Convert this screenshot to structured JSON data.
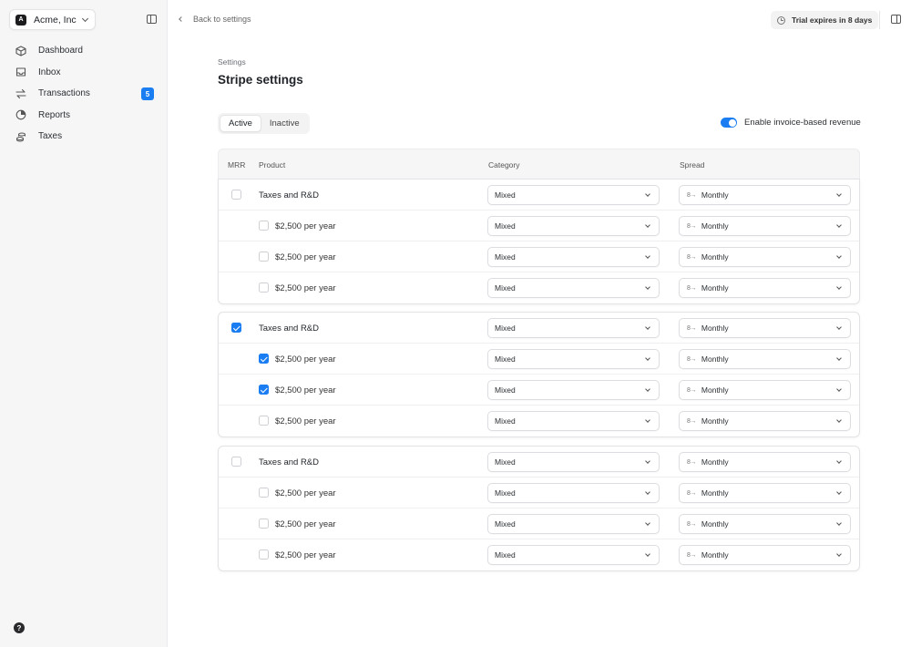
{
  "org": {
    "name": "Acme, Inc",
    "logo": "A"
  },
  "nav": [
    {
      "label": "Dashboard",
      "icon": "cube-icon"
    },
    {
      "label": "Inbox",
      "icon": "inbox-icon"
    },
    {
      "label": "Transactions",
      "icon": "arrows-swap-icon",
      "badge": "5"
    },
    {
      "label": "Reports",
      "icon": "pie-chart-icon"
    },
    {
      "label": "Taxes",
      "icon": "coins-icon"
    }
  ],
  "help": {
    "label": "?"
  },
  "topbar": {
    "back_label": "Back to settings",
    "trial_label": "Trial expires in 8 days"
  },
  "page": {
    "breadcrumb": "Settings",
    "title": "Stripe settings"
  },
  "tabs": [
    {
      "label": "Active",
      "selected": true
    },
    {
      "label": "Inactive",
      "selected": false
    }
  ],
  "toggle": {
    "label": "Enable invoice-based revenue",
    "on": true
  },
  "table": {
    "headers": {
      "mrr": "MRR",
      "product": "Product",
      "category": "Category",
      "spread": "Spread"
    },
    "groups": [
      {
        "rows": [
          {
            "type": "parent",
            "checked": false,
            "product": "Taxes and R&D",
            "category": "Mixed",
            "spread": "Monthly"
          },
          {
            "type": "child",
            "checked": false,
            "product": "$2,500 per year",
            "category": "Mixed",
            "spread": "Monthly"
          },
          {
            "type": "child",
            "checked": false,
            "product": "$2,500 per year",
            "category": "Mixed",
            "spread": "Monthly"
          },
          {
            "type": "child",
            "checked": false,
            "product": "$2,500 per year",
            "category": "Mixed",
            "spread": "Monthly"
          }
        ]
      },
      {
        "rows": [
          {
            "type": "parent",
            "checked": true,
            "product": "Taxes and R&D",
            "category": "Mixed",
            "spread": "Monthly"
          },
          {
            "type": "child",
            "checked": true,
            "product": "$2,500 per year",
            "category": "Mixed",
            "spread": "Monthly"
          },
          {
            "type": "child",
            "checked": true,
            "product": "$2,500 per year",
            "category": "Mixed",
            "spread": "Monthly"
          },
          {
            "type": "child",
            "checked": false,
            "product": "$2,500 per year",
            "category": "Mixed",
            "spread": "Monthly"
          }
        ]
      },
      {
        "rows": [
          {
            "type": "parent",
            "checked": false,
            "product": "Taxes and R&D",
            "category": "Mixed",
            "spread": "Monthly"
          },
          {
            "type": "child",
            "checked": false,
            "product": "$2,500 per year",
            "category": "Mixed",
            "spread": "Monthly"
          },
          {
            "type": "child",
            "checked": false,
            "product": "$2,500 per year",
            "category": "Mixed",
            "spread": "Monthly"
          },
          {
            "type": "child",
            "checked": false,
            "product": "$2,500 per year",
            "category": "Mixed",
            "spread": "Monthly"
          }
        ]
      }
    ]
  },
  "colors": {
    "accent": "#1a7ef2",
    "sidebar_bg": "#f6f6f7",
    "border": "#e3e3e6"
  }
}
